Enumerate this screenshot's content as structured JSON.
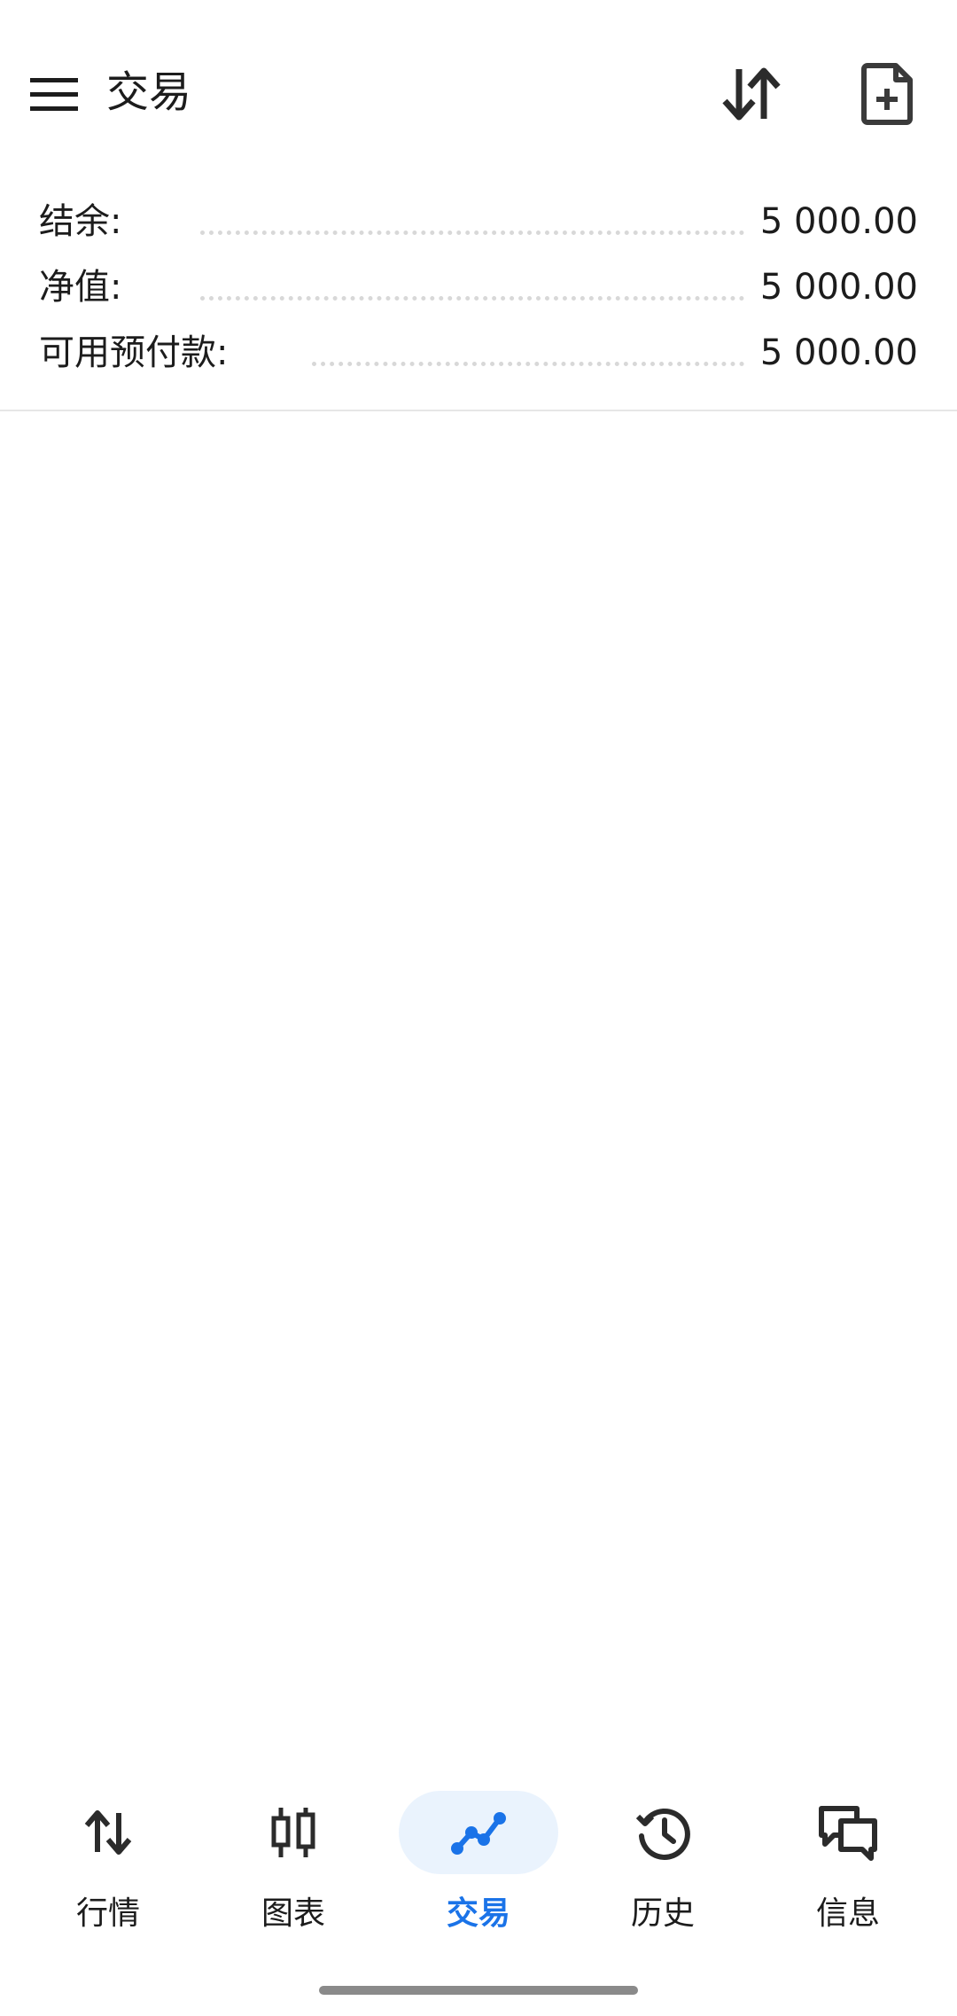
{
  "header": {
    "title": "交易",
    "menu_icon": "menu-icon",
    "sort_icon": "sort-icon",
    "new_order_icon": "file-plus-icon"
  },
  "summary": {
    "balance_label": "结余:",
    "balance_value": "5 000.00",
    "equity_label": "净值:",
    "equity_value": "5 000.00",
    "free_margin_label": "可用预付款:",
    "free_margin_value": "5 000.00"
  },
  "bottom_nav": {
    "items": [
      {
        "label": "行情",
        "icon": "arrows-updown-icon"
      },
      {
        "label": "图表",
        "icon": "candlestick-icon"
      },
      {
        "label": "交易",
        "icon": "trend-line-icon",
        "active": true
      },
      {
        "label": "历史",
        "icon": "history-icon"
      },
      {
        "label": "信息",
        "icon": "chat-icon"
      }
    ]
  },
  "colors": {
    "accent": "#1a73e8",
    "active_pill": "#eaf3fd",
    "text": "#1c1c1c",
    "dots": "#d8d8d8"
  }
}
